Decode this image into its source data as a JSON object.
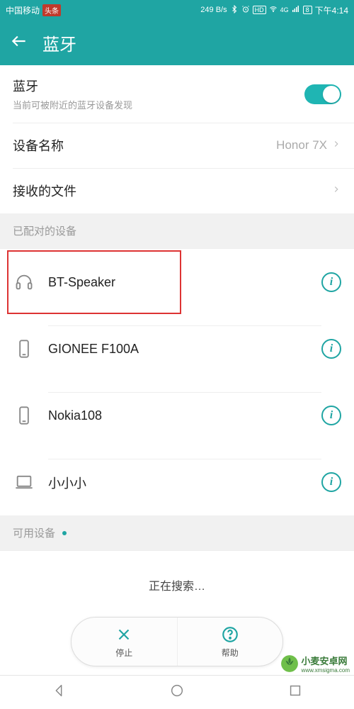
{
  "status_bar": {
    "carrier": "中国移动",
    "news_badge": "头条",
    "data_rate": "249 B/s",
    "battery": "8",
    "time": "下午4:14"
  },
  "header": {
    "title": "蓝牙"
  },
  "rows": {
    "bt": {
      "title": "蓝牙",
      "subtitle": "当前可被附近的蓝牙设备发现"
    },
    "device_name": {
      "title": "设备名称",
      "value": "Honor 7X"
    },
    "received_files": {
      "title": "接收的文件"
    }
  },
  "sections": {
    "paired": "已配对的设备",
    "available": "可用设备"
  },
  "devices": [
    {
      "name": "BT-Speaker",
      "icon": "headphones"
    },
    {
      "name": "GIONEE F100A",
      "icon": "phone"
    },
    {
      "name": "Nokia108",
      "icon": "phone"
    },
    {
      "name": "小小小",
      "icon": "laptop"
    }
  ],
  "searching_text": "正在搜索…",
  "pill": {
    "stop": "停止",
    "help": "帮助"
  },
  "watermark": {
    "text": "小麦安卓网",
    "sub": "www.xmsigma.com"
  }
}
